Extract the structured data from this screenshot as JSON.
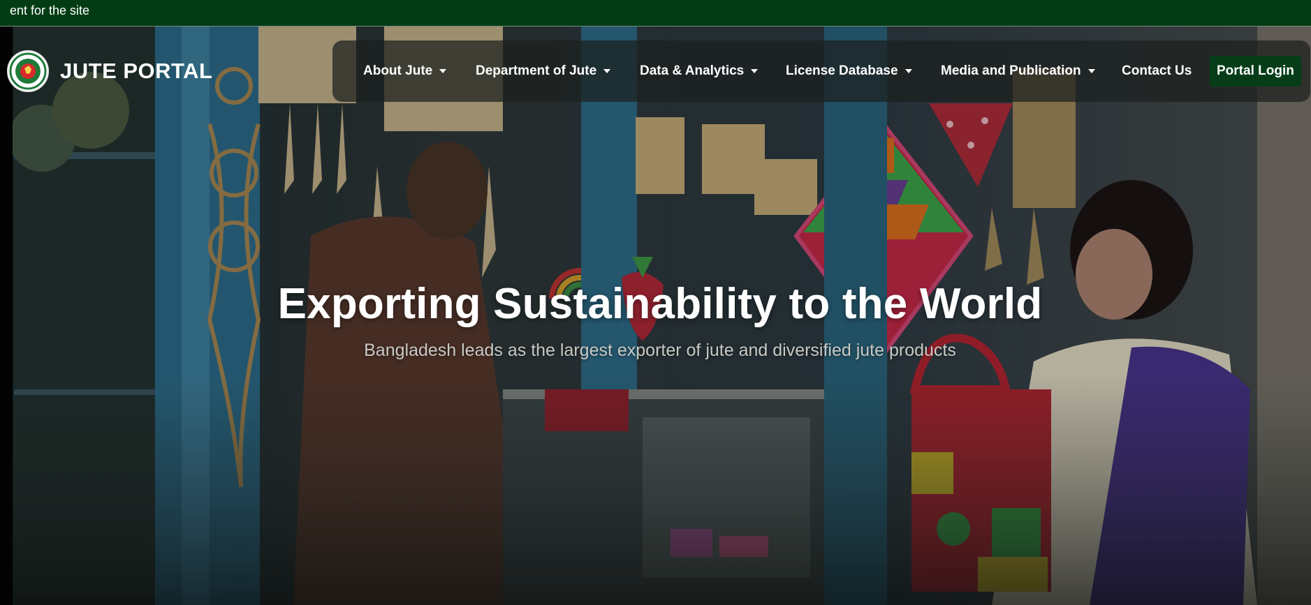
{
  "announcement": {
    "text": "ent for the site"
  },
  "brand": {
    "title": "JUTE PORTAL",
    "emblem_icon": "bangladesh-govt-seal-icon"
  },
  "nav": {
    "items": [
      {
        "label": "About Jute",
        "has_dropdown": true
      },
      {
        "label": "Department of Jute",
        "has_dropdown": true
      },
      {
        "label": "Data & Analytics",
        "has_dropdown": true
      },
      {
        "label": "License Database",
        "has_dropdown": true
      },
      {
        "label": "Media and Publication",
        "has_dropdown": true
      },
      {
        "label": "Contact Us",
        "has_dropdown": false
      }
    ],
    "login_label": "Portal Login"
  },
  "hero": {
    "headline": "Exporting Sustainability to the World",
    "subheadline": "Bangladesh leads as the largest exporter of jute and diversified jute products",
    "background": "photo of a jute handicraft shop with hanging macrame, tassels, kites and bags"
  },
  "colors": {
    "topbar_bg": "#023c14",
    "login_bg": "#063d18",
    "text_primary": "#ffffff",
    "text_muted": "#c9c9c4"
  }
}
